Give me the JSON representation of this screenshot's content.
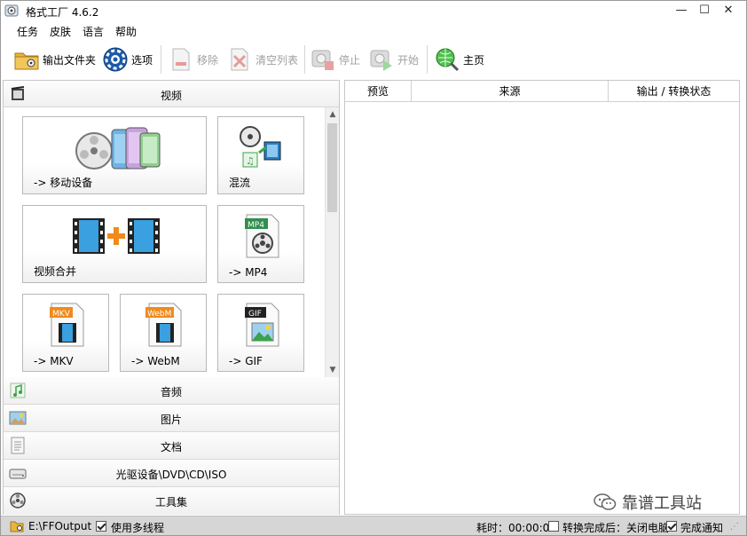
{
  "window": {
    "title": "格式工厂 4.6.2",
    "controls": {
      "minimize": "—",
      "maximize": "☐",
      "close": "✕"
    }
  },
  "menu": [
    "任务",
    "皮肤",
    "语言",
    "帮助"
  ],
  "toolbar": {
    "output_folder": "输出文件夹",
    "options": "选项",
    "remove": "移除",
    "clear_list": "清空列表",
    "stop": "停止",
    "start": "开始",
    "home": "主页"
  },
  "left": {
    "video_header": "视频",
    "tiles": [
      "-> 移动设备",
      "混流",
      "视频合并",
      "-> MP4",
      "-> MKV",
      "-> WebM",
      "-> GIF"
    ],
    "badges": {
      "mp4": "MP4",
      "mkv": "MKV",
      "webm": "WebM",
      "gif": "GIF"
    },
    "categories": [
      "音频",
      "图片",
      "文档",
      "光驱设备\\DVD\\CD\\ISO",
      "工具集"
    ]
  },
  "right": {
    "columns": [
      "预览",
      "来源",
      "输出 / 转换状态"
    ]
  },
  "status": {
    "path": "E:\\FFOutput",
    "multithread": "使用多线程",
    "multithread_checked": true,
    "elapsed": "耗时：00:00:00",
    "shutdown_after": "转换完成后：关闭电脑",
    "shutdown_checked": false,
    "notify": "完成通知",
    "notify_checked": true
  },
  "watermark": "靠谱工具站",
  "colors": {
    "accent_orange": "#f08a1c",
    "film_blue": "#2a7fc0",
    "green": "#3aa34a",
    "status_bg": "#d6d6d6"
  }
}
